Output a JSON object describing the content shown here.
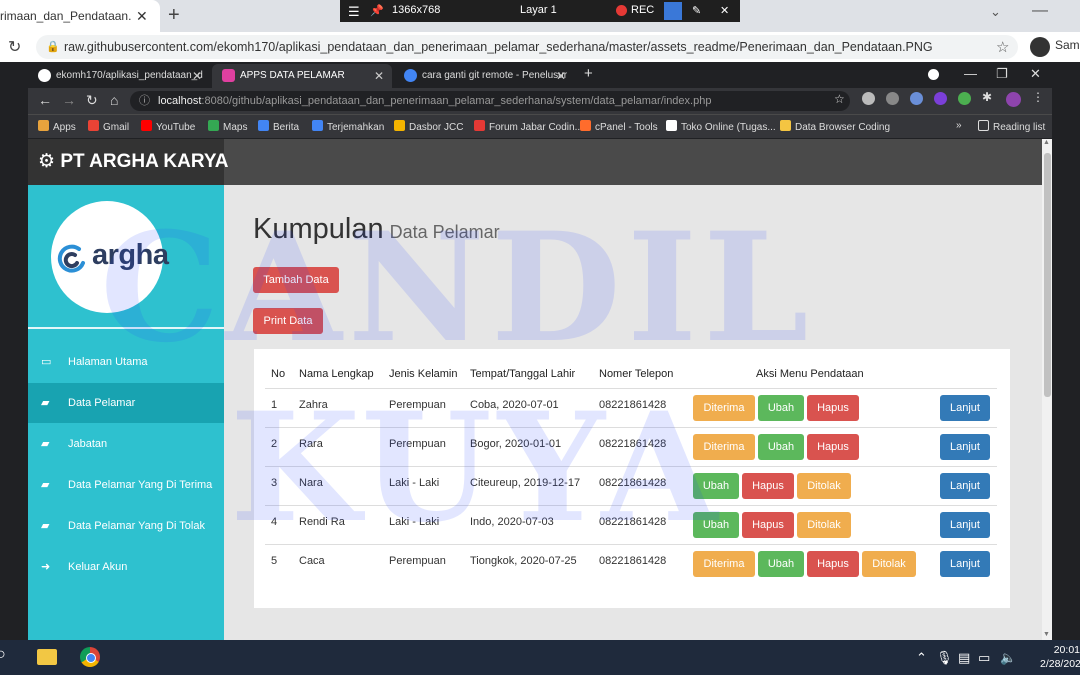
{
  "outer_browser": {
    "tab_title": "rimaan_dan_Pendataan.PNG",
    "tab_close": "✕",
    "new_tab": "+",
    "url": "raw.githubusercontent.com/ekomh170/aplikasi_pendataan_dan_penerimaan_pelamar_sederhana/master/assets_readme/Penerimaan_dan_Pendataan.PNG",
    "profile_label": "Sama"
  },
  "recorder": {
    "resolution": "1366x768",
    "layer": "Layar 1",
    "rec": "REC"
  },
  "inner_browser": {
    "tabs": [
      {
        "label": "ekomh170/aplikasi_pendataan_d",
        "color": "#ffffff"
      },
      {
        "label": "APPS DATA PELAMAR",
        "color": "#e040a0"
      },
      {
        "label": "cara ganti git remote - Penelusur",
        "color": "#4285f4"
      }
    ],
    "url_host": "localhost",
    "url_rest": ":8080/github/aplikasi_pendataan_dan_penerimaan_pelamar_sederhana/system/data_pelamar/index.php",
    "bookmarks": [
      {
        "label": "Apps",
        "color": "#e8a33d"
      },
      {
        "label": "Gmail",
        "color": "#ea4335"
      },
      {
        "label": "YouTube",
        "color": "#ff0000"
      },
      {
        "label": "Maps",
        "color": "#34a853"
      },
      {
        "label": "Berita",
        "color": "#4285f4"
      },
      {
        "label": "Terjemahkan",
        "color": "#4285f4"
      },
      {
        "label": "Dasbor JCC",
        "color": "#f4b400"
      },
      {
        "label": "Forum Jabar Codin...",
        "color": "#e53935"
      },
      {
        "label": "cPanel - Tools",
        "color": "#ff6c2c"
      },
      {
        "label": "Toko Online (Tugas...",
        "color": "#ffffff"
      },
      {
        "label": "Data Browser Coding",
        "color": "#f4c542"
      }
    ],
    "more": "»",
    "reading_list": "Reading list"
  },
  "app": {
    "brand": "PT ARGHA KARYA",
    "logo_text": "argha",
    "nav": [
      {
        "label": "Halaman Utama",
        "icon": "monitor-icon"
      },
      {
        "label": "Data Pelamar",
        "icon": "book-icon"
      },
      {
        "label": "Jabatan",
        "icon": "book-icon"
      },
      {
        "label": "Data Pelamar Yang Di Terima",
        "icon": "book-icon"
      },
      {
        "label": "Data Pelamar Yang Di Tolak",
        "icon": "book-icon"
      },
      {
        "label": "Keluar Akun",
        "icon": "logout-icon"
      }
    ],
    "title": "Kumpulan",
    "subtitle": "Data Pelamar",
    "btn_tambah": "Tambah Data",
    "btn_print": "Print Data",
    "table": {
      "headers": [
        "No",
        "Nama Lengkap",
        "Jenis Kelamin",
        "Tempat/Tanggal Lahir",
        "Nomer Telepon",
        "Aksi Menu Pendataan"
      ],
      "rows": [
        {
          "no": "1",
          "nama": "Zahra",
          "jk": "Perempuan",
          "ttl": "Coba, 2020-07-01",
          "telp": "08221861428",
          "actions": [
            "Diterima",
            "Ubah",
            "Hapus"
          ]
        },
        {
          "no": "2",
          "nama": "Rara",
          "jk": "Perempuan",
          "ttl": "Bogor, 2020-01-01",
          "telp": "08221861428",
          "actions": [
            "Diterima",
            "Ubah",
            "Hapus"
          ]
        },
        {
          "no": "3",
          "nama": "Nara",
          "jk": "Laki - Laki",
          "ttl": "Citeureup, 2019-12-17",
          "telp": "08221861428",
          "actions": [
            "Ubah",
            "Hapus",
            "Ditolak"
          ]
        },
        {
          "no": "4",
          "nama": "Rendi Ra",
          "jk": "Laki - Laki",
          "ttl": "Indo, 2020-07-03",
          "telp": "08221861428",
          "actions": [
            "Ubah",
            "Hapus",
            "Ditolak"
          ]
        },
        {
          "no": "5",
          "nama": "Caca",
          "jk": "Perempuan",
          "ttl": "Tiongkok, 2020-07-25",
          "telp": "08221861428",
          "actions": [
            "Diterima",
            "Ubah",
            "Hapus",
            "Ditolak"
          ]
        }
      ],
      "lanjut": "Lanjut"
    }
  },
  "watermark": {
    "line1": "CANDIL",
    "line2": "KUYA"
  },
  "taskbar": {
    "time": "20:01",
    "date": "2/28/202"
  }
}
